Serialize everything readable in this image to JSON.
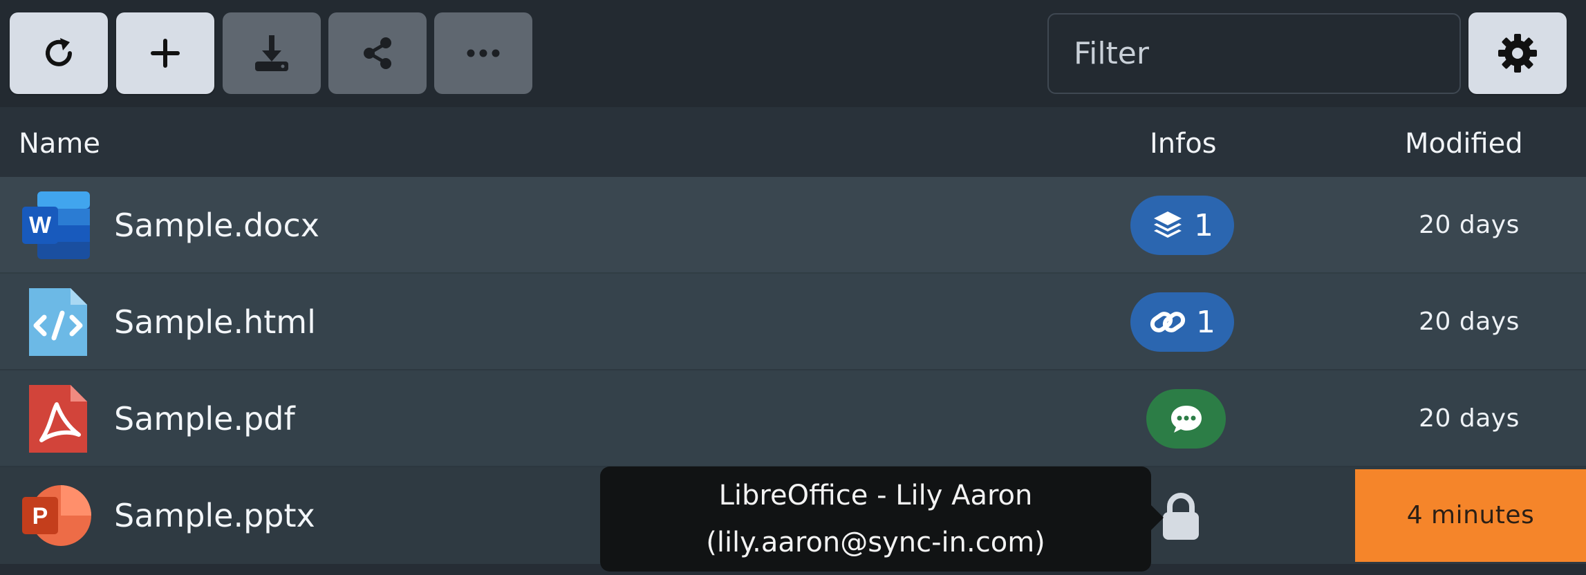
{
  "toolbar": {
    "buttons": [
      {
        "icon": "refresh-icon",
        "style": "light"
      },
      {
        "icon": "plus-icon",
        "style": "light"
      },
      {
        "icon": "download-icon",
        "style": "dim"
      },
      {
        "icon": "share-icon",
        "style": "dim"
      },
      {
        "icon": "more-icon",
        "style": "dim"
      }
    ],
    "filter_placeholder": "Filter",
    "settings_icon": "gear-icon"
  },
  "table": {
    "headers": {
      "name": "Name",
      "infos": "Infos",
      "modified": "Modified"
    },
    "rows": [
      {
        "name": "Sample.docx",
        "file_icon": "word-file-icon",
        "info": {
          "type": "versions",
          "icon": "layers-icon",
          "count": "1",
          "color": "#2b66b0"
        },
        "modified": "20 days"
      },
      {
        "name": "Sample.html",
        "file_icon": "html-file-icon",
        "info": {
          "type": "links",
          "icon": "link-icon",
          "count": "1",
          "color": "#2b66b0"
        },
        "modified": "20 days"
      },
      {
        "name": "Sample.pdf",
        "file_icon": "pdf-file-icon",
        "info": {
          "type": "comments",
          "icon": "comment-icon",
          "color": "#2c7d46"
        },
        "modified": "20 days"
      },
      {
        "name": "Sample.pptx",
        "file_icon": "powerpoint-file-icon",
        "info": {
          "type": "lock",
          "icon": "lock-icon"
        },
        "modified": "4 minutes",
        "highlight_color": "#f5852a"
      }
    ]
  },
  "tooltip": {
    "line1": "LibreOffice - Lily Aaron",
    "line2": "(lily.aaron@sync-in.com)"
  }
}
